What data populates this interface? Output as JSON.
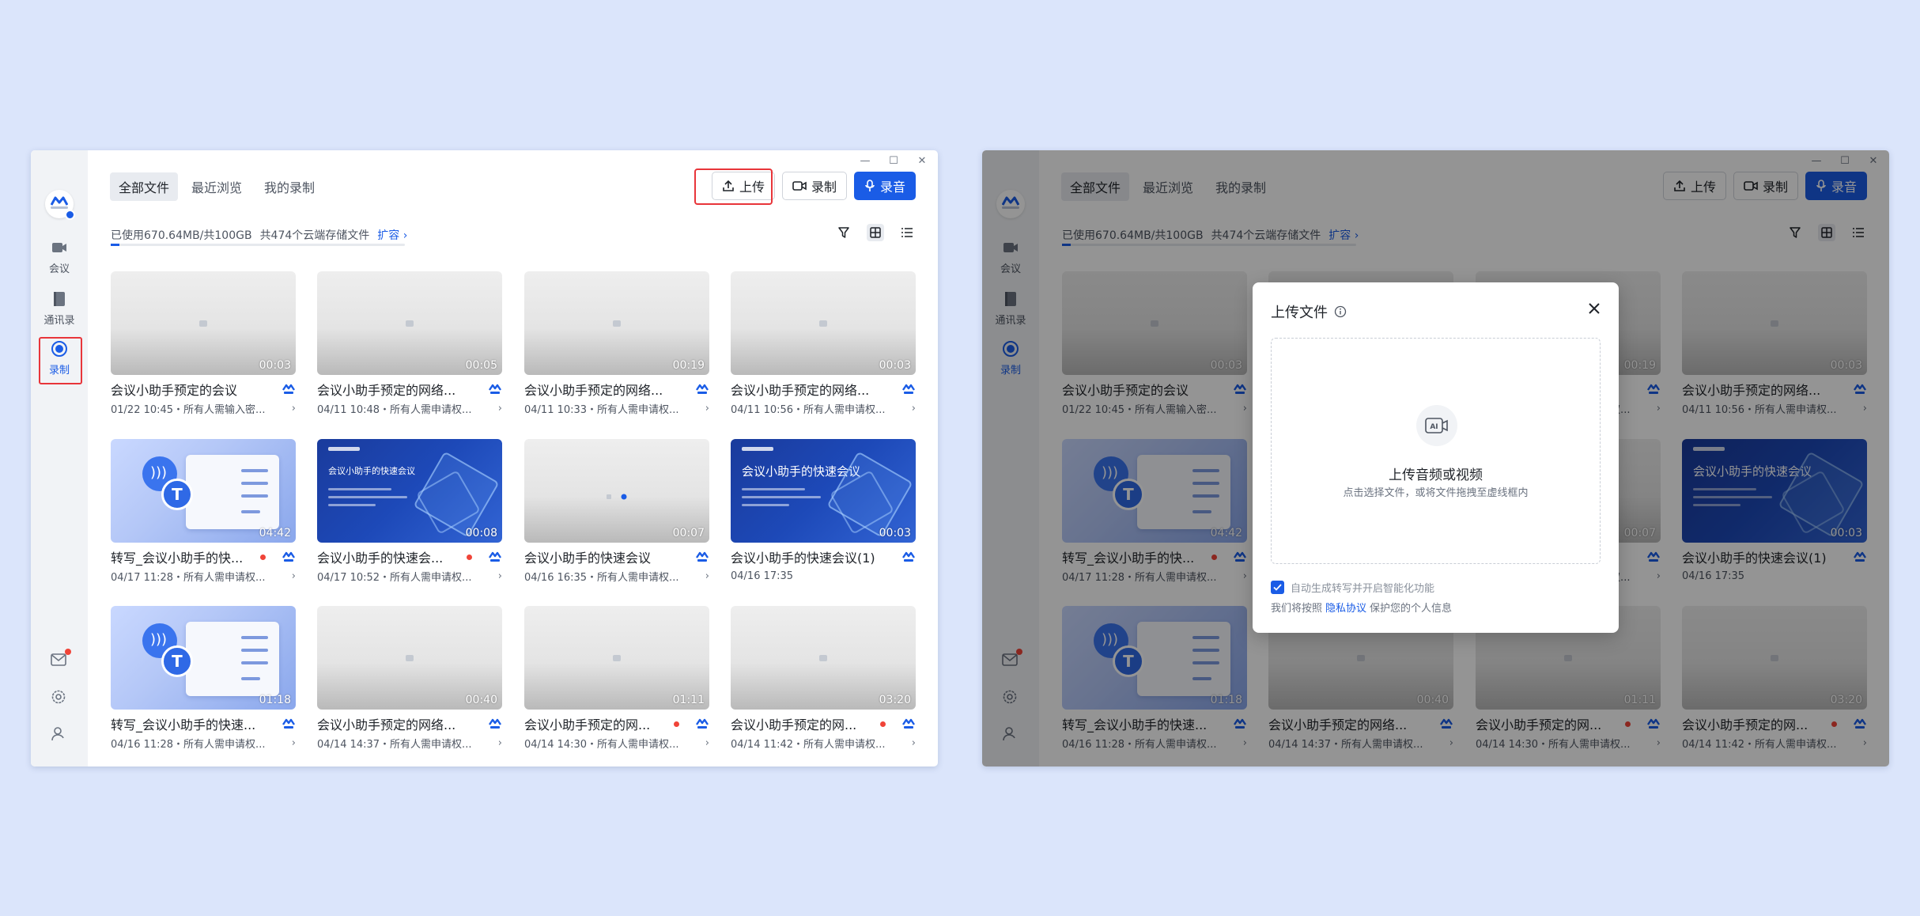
{
  "sidebar": {
    "items": [
      {
        "label": "会议"
      },
      {
        "label": "通讯录"
      },
      {
        "label": "录制"
      }
    ]
  },
  "tabs": [
    {
      "label": "全部文件"
    },
    {
      "label": "最近浏览"
    },
    {
      "label": "我的录制"
    }
  ],
  "toolbar": {
    "upload_label": "上传",
    "record_label": "录制",
    "audio_label": "录音"
  },
  "storage": {
    "used_text": "已使用670.64MB/共100GB",
    "count_text": "共474个云端存储文件",
    "expand_label": "扩容 ›",
    "used_fraction": 0.03
  },
  "files": [
    {
      "title": "会议小助手预定的会议",
      "meta": "01/22 10:45・所有人需输入密...",
      "duration": "00:03",
      "thumb": "gray",
      "rec_dot": false
    },
    {
      "title": "会议小助手预定的网络...",
      "meta": "04/11 10:48・所有人需申请权...",
      "duration": "00:05",
      "thumb": "gray",
      "rec_dot": false
    },
    {
      "title": "会议小助手预定的网络...",
      "meta": "04/11 10:33・所有人需申请权...",
      "duration": "00:19",
      "thumb": "gray",
      "rec_dot": false
    },
    {
      "title": "会议小助手预定的网络...",
      "meta": "04/11 10:56・所有人需申请权...",
      "duration": "00:03",
      "thumb": "gray",
      "rec_dot": false
    },
    {
      "title": "转写_会议小助手的快...",
      "meta": "04/17 11:28・所有人需申请权...",
      "duration": "04:42",
      "thumb": "ai",
      "rec_dot": true
    },
    {
      "title": "会议小助手的快速会...",
      "meta": "04/17 10:52・所有人需申请权...",
      "duration": "00:08",
      "thumb": "blue",
      "rec_dot": true,
      "slide_title": "会议小助手的快速会议"
    },
    {
      "title": "会议小助手的快速会议",
      "meta": "04/16 16:35・所有人需申请权...",
      "duration": "00:07",
      "thumb": "gray",
      "rec_dot": false
    },
    {
      "title": "会议小助手的快速会议(1)",
      "meta": "04/16 17:35",
      "duration": "00:03",
      "thumb": "blue",
      "rec_dot": false,
      "slide_title": "会议小助手的快速会议"
    },
    {
      "title": "转写_会议小助手的快速...",
      "meta": "04/16 11:28・所有人需申请权...",
      "duration": "01:18",
      "thumb": "ai",
      "rec_dot": false
    },
    {
      "title": "会议小助手预定的网络...",
      "meta": "04/14 14:37・所有人需申请权...",
      "duration": "00:40",
      "thumb": "gray",
      "rec_dot": false
    },
    {
      "title": "会议小助手预定的网...",
      "meta": "04/14 14:30・所有人需申请权...",
      "duration": "01:11",
      "thumb": "gray",
      "rec_dot": true
    },
    {
      "title": "会议小助手预定的网...",
      "meta": "04/14 11:42・所有人需申请权...",
      "duration": "03:20",
      "thumb": "gray",
      "rec_dot": true
    }
  ],
  "upload_modal": {
    "title": "上传文件",
    "drop_title": "上传音频或视频",
    "drop_sub": "点击选择文件，或将文件拖拽至虚线框内",
    "ai_badge": "AI",
    "option_label": "自动生成转写并开启智能化功能",
    "privacy_prefix": "我们将按照",
    "privacy_link": "隐私协议",
    "privacy_suffix": "保护您的个人信息"
  },
  "colors": {
    "accent": "#1a5ce6",
    "highlight": "#e8353a",
    "rec_dot": "#f04438"
  }
}
